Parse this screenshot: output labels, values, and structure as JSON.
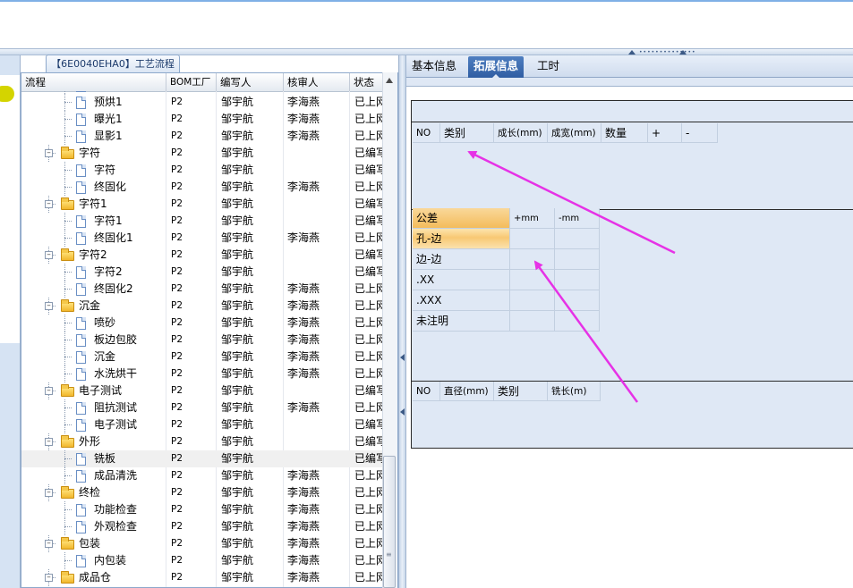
{
  "tree_panel": {
    "tab_title": "【6E0040EHA0】工艺流程",
    "columns": [
      "流程",
      "BOM工厂",
      "编写人",
      "核审人",
      "状态"
    ],
    "rows": [
      {
        "label": "",
        "level": 2,
        "kind": "doc",
        "bom": "P2",
        "author": "邹宇航",
        "reviewer": "李海燕",
        "status": "已上网"
      },
      {
        "label": "预烘1",
        "level": 2,
        "kind": "doc",
        "bom": "P2",
        "author": "邹宇航",
        "reviewer": "李海燕",
        "status": "已上网"
      },
      {
        "label": "曝光1",
        "level": 2,
        "kind": "doc",
        "bom": "P2",
        "author": "邹宇航",
        "reviewer": "李海燕",
        "status": "已上网"
      },
      {
        "label": "显影1",
        "level": 2,
        "kind": "doc",
        "bom": "P2",
        "author": "邹宇航",
        "reviewer": "李海燕",
        "status": "已上网"
      },
      {
        "label": "字符",
        "level": 1,
        "kind": "folder",
        "bom": "P2",
        "author": "邹宇航",
        "reviewer": "",
        "status": "已编写"
      },
      {
        "label": "字符",
        "level": 2,
        "kind": "doc",
        "bom": "P2",
        "author": "邹宇航",
        "reviewer": "",
        "status": "已编写"
      },
      {
        "label": "终固化",
        "level": 2,
        "kind": "doc",
        "bom": "P2",
        "author": "邹宇航",
        "reviewer": "李海燕",
        "status": "已上网"
      },
      {
        "label": "字符1",
        "level": 1,
        "kind": "folder",
        "bom": "P2",
        "author": "邹宇航",
        "reviewer": "",
        "status": "已编写"
      },
      {
        "label": "字符1",
        "level": 2,
        "kind": "doc",
        "bom": "P2",
        "author": "邹宇航",
        "reviewer": "",
        "status": "已编写"
      },
      {
        "label": "终固化1",
        "level": 2,
        "kind": "doc",
        "bom": "P2",
        "author": "邹宇航",
        "reviewer": "李海燕",
        "status": "已上网"
      },
      {
        "label": "字符2",
        "level": 1,
        "kind": "folder",
        "bom": "P2",
        "author": "邹宇航",
        "reviewer": "",
        "status": "已编写"
      },
      {
        "label": "字符2",
        "level": 2,
        "kind": "doc",
        "bom": "P2",
        "author": "邹宇航",
        "reviewer": "",
        "status": "已编写"
      },
      {
        "label": "终固化2",
        "level": 2,
        "kind": "doc",
        "bom": "P2",
        "author": "邹宇航",
        "reviewer": "李海燕",
        "status": "已上网"
      },
      {
        "label": "沉金",
        "level": 1,
        "kind": "folder",
        "bom": "P2",
        "author": "邹宇航",
        "reviewer": "李海燕",
        "status": "已上网"
      },
      {
        "label": "喷砂",
        "level": 2,
        "kind": "doc",
        "bom": "P2",
        "author": "邹宇航",
        "reviewer": "李海燕",
        "status": "已上网"
      },
      {
        "label": "板边包胶",
        "level": 2,
        "kind": "doc",
        "bom": "P2",
        "author": "邹宇航",
        "reviewer": "李海燕",
        "status": "已上网"
      },
      {
        "label": "沉金",
        "level": 2,
        "kind": "doc",
        "bom": "P2",
        "author": "邹宇航",
        "reviewer": "李海燕",
        "status": "已上网"
      },
      {
        "label": "水洗烘干",
        "level": 2,
        "kind": "doc",
        "bom": "P2",
        "author": "邹宇航",
        "reviewer": "李海燕",
        "status": "已上网"
      },
      {
        "label": "电子测试",
        "level": 1,
        "kind": "folder",
        "bom": "P2",
        "author": "邹宇航",
        "reviewer": "",
        "status": "已编写"
      },
      {
        "label": "阻抗测试",
        "level": 2,
        "kind": "doc",
        "bom": "P2",
        "author": "邹宇航",
        "reviewer": "李海燕",
        "status": "已上网"
      },
      {
        "label": "电子测试",
        "level": 2,
        "kind": "doc",
        "bom": "P2",
        "author": "邹宇航",
        "reviewer": "",
        "status": "已编写"
      },
      {
        "label": "外形",
        "level": 1,
        "kind": "folder",
        "bom": "P2",
        "author": "邹宇航",
        "reviewer": "",
        "status": "已编写"
      },
      {
        "label": "铣板",
        "level": 2,
        "kind": "doc",
        "bom": "P2",
        "author": "邹宇航",
        "reviewer": "",
        "status": "已编写",
        "selected": true
      },
      {
        "label": "成品清洗",
        "level": 2,
        "kind": "doc",
        "bom": "P2",
        "author": "邹宇航",
        "reviewer": "李海燕",
        "status": "已上网"
      },
      {
        "label": "终检",
        "level": 1,
        "kind": "folder",
        "bom": "P2",
        "author": "邹宇航",
        "reviewer": "李海燕",
        "status": "已上网"
      },
      {
        "label": "功能检查",
        "level": 2,
        "kind": "doc",
        "bom": "P2",
        "author": "邹宇航",
        "reviewer": "李海燕",
        "status": "已上网"
      },
      {
        "label": "外观检查",
        "level": 2,
        "kind": "doc",
        "bom": "P2",
        "author": "邹宇航",
        "reviewer": "李海燕",
        "status": "已上网"
      },
      {
        "label": "包装",
        "level": 1,
        "kind": "folder",
        "bom": "P2",
        "author": "邹宇航",
        "reviewer": "李海燕",
        "status": "已上网"
      },
      {
        "label": "内包装",
        "level": 2,
        "kind": "doc",
        "bom": "P2",
        "author": "邹宇航",
        "reviewer": "李海燕",
        "status": "已上网"
      },
      {
        "label": "成品仓",
        "level": 1,
        "kind": "folder",
        "bom": "P2",
        "author": "邹宇航",
        "reviewer": "李海燕",
        "status": "已上网"
      }
    ]
  },
  "right_panel": {
    "tabs": [
      {
        "label": "基本信息",
        "active": false
      },
      {
        "label": "拓展信息",
        "active": true
      },
      {
        "label": "工时",
        "active": false
      }
    ],
    "size_table": {
      "headers": [
        "NO",
        "类别",
        "成长(mm)",
        "成宽(mm)",
        "数量",
        "+",
        "-"
      ]
    },
    "tolerance_table": {
      "headers": [
        "公差",
        "+mm",
        "-mm"
      ],
      "rows": [
        "孔-边",
        "边-边",
        ".XX",
        ".XXX",
        "未注明"
      ],
      "selected_row": 0
    },
    "drill_table": {
      "headers": [
        "NO",
        "直径(mm)",
        "类别",
        "铣长(m)"
      ]
    }
  },
  "annotation_color": "#e632e6"
}
